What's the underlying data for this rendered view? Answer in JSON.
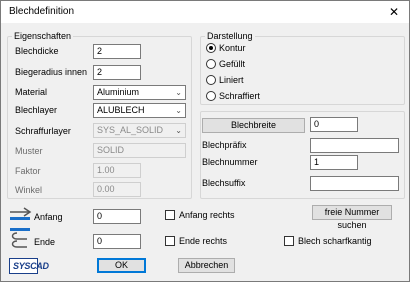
{
  "window": {
    "title": "Blechdefinition",
    "close_glyph": "✕"
  },
  "eigenschaften": {
    "legend": "Eigenschaften",
    "blechdicke": {
      "label": "Blechdicke",
      "value": "2"
    },
    "biegeradius": {
      "label": "Biegeradius innen",
      "value": "2"
    },
    "material": {
      "label": "Material",
      "value": "Aluminium"
    },
    "blechlayer": {
      "label": "Blechlayer",
      "value": "ALUBLECH"
    },
    "schraffurlayer": {
      "label": "Schraffurlayer",
      "value": "SYS_AL_SOLID"
    },
    "muster": {
      "label": "Muster",
      "value": "SOLID"
    },
    "faktor": {
      "label": "Faktor",
      "value": "1.00"
    },
    "winkel": {
      "label": "Winkel",
      "value": "0.00"
    }
  },
  "darstellung": {
    "legend": "Darstellung",
    "options": [
      "Kontur",
      "Gefüllt",
      "Liniert",
      "Schraffiert"
    ],
    "selected": "Kontur"
  },
  "rechts": {
    "blechbreite_button": "Blechbreite",
    "blechbreite_value": "0",
    "blechpraefix_label": "Blechpräfix",
    "blechpraefix_value": "",
    "blechnummer_label": "Blechnummer",
    "blechnummer_value": "1",
    "blechsuffix_label": "Blechsuffix",
    "blechsuffix_value": "",
    "freie_nummer_button": "freie Nummer suchen"
  },
  "unten": {
    "anfang_label": "Anfang",
    "anfang_value": "0",
    "ende_label": "Ende",
    "ende_value": "0",
    "anfang_rechts": "Anfang rechts",
    "ende_rechts": "Ende rechts",
    "blech_scharfkantig": "Blech scharfkantig"
  },
  "buttons": {
    "ok": "OK",
    "abbrechen": "Abbrechen"
  },
  "logo": {
    "text": "SYSCAD"
  }
}
